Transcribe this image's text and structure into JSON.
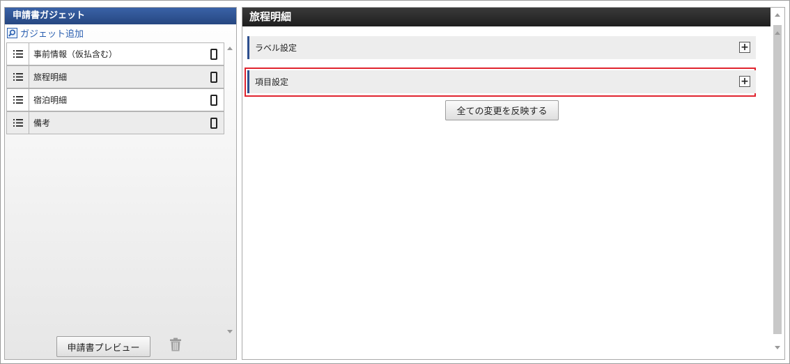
{
  "left_panel": {
    "title": "申請書ガジェット",
    "add_gadget_label": "ガジェット追加",
    "gadgets": [
      {
        "label": "事前情報（仮払含む）",
        "icon": "phone-icon"
      },
      {
        "label": "旅程明細",
        "icon": "phone-icon"
      },
      {
        "label": "宿泊明細",
        "icon": "phone-icon"
      },
      {
        "label": "備考",
        "icon": "phone-icon"
      }
    ],
    "preview_button": "申請書プレビュー",
    "trash_icon": "trash-icon"
  },
  "right_panel": {
    "title": "旅程明細",
    "sections": [
      {
        "label": "ラベル設定",
        "expand_icon": "plus-icon"
      },
      {
        "label": "項目設定",
        "expand_icon": "plus-icon",
        "highlighted": true
      }
    ],
    "apply_button": "全ての変更を反映する"
  },
  "colors": {
    "left_header": "#2d4f8e",
    "right_header": "#2b2b2b",
    "highlight": "#e0232e",
    "section_accent": "#2d4f8e",
    "link": "#2a5fb0"
  }
}
